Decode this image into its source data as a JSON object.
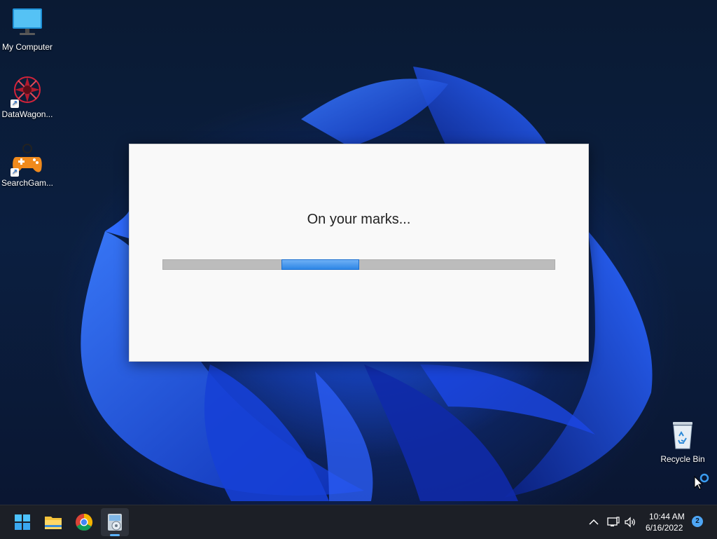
{
  "desktop": {
    "icons": [
      {
        "label": "My Computer",
        "icon": "monitor-icon"
      },
      {
        "label": "DataWagon...",
        "icon": "datawagon-icon"
      },
      {
        "label": "SearchGam...",
        "icon": "gamepad-icon"
      },
      {
        "label": "Recycle Bin",
        "icon": "recycle-bin-icon"
      }
    ]
  },
  "dialog": {
    "message": "On your marks...",
    "progress_style": "marquee"
  },
  "taskbar": {
    "apps": [
      {
        "icon": "windows-start-icon"
      },
      {
        "icon": "file-explorer-icon"
      },
      {
        "icon": "chrome-icon"
      },
      {
        "icon": "installer-icon",
        "active": true
      }
    ],
    "tray": {
      "time": "10:44 AM",
      "date": "6/16/2022",
      "notification_count": "2"
    }
  },
  "colors": {
    "accent": "#2e86e6",
    "taskbar_bg": "#1c1f26",
    "desktop_bg": "#0b1f40"
  }
}
